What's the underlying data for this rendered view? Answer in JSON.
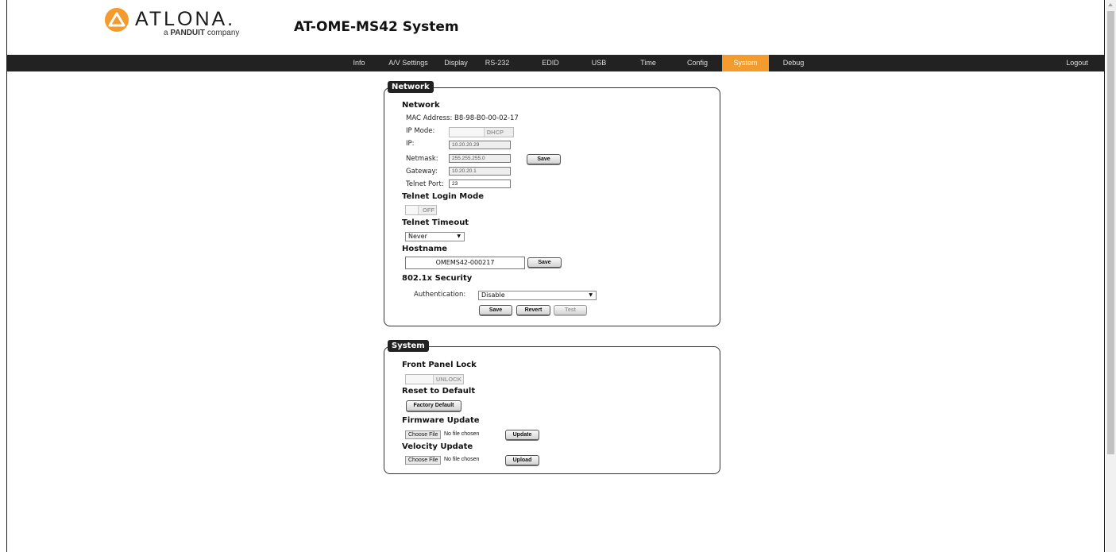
{
  "header": {
    "logo_text": "ATLONA.",
    "logo_tagline_prefix": "a",
    "logo_tagline_brand": "PANDUIT",
    "logo_tagline_suffix": "company",
    "page_title": "AT-OME-MS42  System"
  },
  "nav": {
    "items": [
      {
        "label": "Info"
      },
      {
        "label": "A/V Settings"
      },
      {
        "label": "Display"
      },
      {
        "label": "RS-232"
      },
      {
        "label": "EDID"
      },
      {
        "label": "USB"
      },
      {
        "label": "Time"
      },
      {
        "label": "Config"
      },
      {
        "label": "System",
        "active": true
      },
      {
        "label": "Debug"
      }
    ],
    "logout_label": "Logout",
    "active_color": "#f39b2d",
    "bar_color": "#222222"
  },
  "network_panel": {
    "legend": "Network",
    "section_title": "Network",
    "mac_label": "MAC Address:",
    "mac_value": "B8-98-B0-00-02-17",
    "ip_mode_label": "IP Mode:",
    "ip_mode_value": "DHCP",
    "ip_label": "IP:",
    "ip_value": "10.20.20.29",
    "netmask_label": "Netmask:",
    "netmask_value": "255.255.255.0",
    "gateway_label": "Gateway:",
    "gateway_value": "10.20.20.1",
    "telnet_port_label": "Telnet Port:",
    "telnet_port_value": "23",
    "save_label": "Save",
    "telnet_login_title": "Telnet Login Mode",
    "telnet_login_value": "OFF",
    "telnet_timeout_title": "Telnet Timeout",
    "telnet_timeout_value": "Never",
    "hostname_title": "Hostname",
    "hostname_value": "OMEMS42-000217",
    "hostname_save_label": "Save",
    "security_title": "802.1x Security",
    "auth_label": "Authentication:",
    "auth_value": "Disable",
    "sec_save_label": "Save",
    "sec_revert_label": "Revert",
    "sec_test_label": "Test"
  },
  "system_panel": {
    "legend": "System",
    "front_panel_title": "Front Panel Lock",
    "front_panel_value": "UNLOCK",
    "reset_title": "Reset to Default",
    "factory_default_label": "Factory Default",
    "firmware_title": "Firmware Update",
    "choose_file_label": "Choose File",
    "no_file_label": "No file chosen",
    "update_label": "Update",
    "velocity_title": "Velocity Update",
    "upload_label": "Upload"
  },
  "icons": {
    "logo_mark": "atlona-logo-icon",
    "dropdown_arrow": "chevron-down-icon"
  }
}
